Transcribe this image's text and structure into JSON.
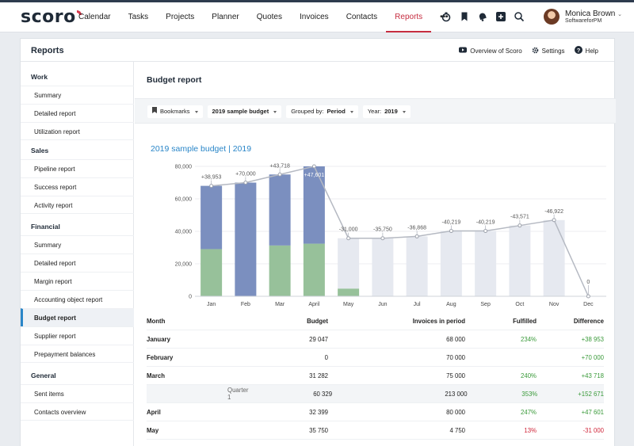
{
  "app": {
    "logo": "scoro",
    "nav": [
      "Calendar",
      "Tasks",
      "Projects",
      "Planner",
      "Quotes",
      "Invoices",
      "Contacts",
      "Reports",
      "•••"
    ],
    "active_nav": "Reports",
    "icons": [
      "timer-icon",
      "bookmark-icon",
      "bell-icon",
      "plus-icon",
      "search-icon"
    ],
    "user": {
      "name": "Monica Brown",
      "company": "SoftwareforPM"
    }
  },
  "panel": {
    "title": "Reports",
    "actions": [
      {
        "icon": "youtube-icon",
        "label": "Overview of Scoro"
      },
      {
        "icon": "gear-icon",
        "label": "Settings"
      },
      {
        "icon": "help-icon",
        "label": "Help"
      }
    ]
  },
  "sidebar": [
    {
      "section": "Work",
      "items": [
        "Summary",
        "Detailed report",
        "Utilization report"
      ]
    },
    {
      "section": "Sales",
      "items": [
        "Pipeline report",
        "Success report",
        "Activity report"
      ]
    },
    {
      "section": "Financial",
      "items": [
        "Summary",
        "Detailed report",
        "Margin report",
        "Accounting object report",
        "Budget report",
        "Supplier report",
        "Prepayment balances"
      ]
    },
    {
      "section": "General",
      "items": [
        "Sent items",
        "Contacts overview"
      ]
    }
  ],
  "active_sidebar": "Budget report",
  "content": {
    "title": "Budget report",
    "filters": {
      "bookmarks": "Bookmarks",
      "budget": "2019 sample budget",
      "grouped_label": "Grouped by:",
      "grouped_value": "Period",
      "year_label": "Year:",
      "year_value": "2019"
    },
    "chart_title": "2019 sample budget | 2019"
  },
  "chart_data": {
    "type": "bar",
    "categories": [
      "Jan",
      "Feb",
      "Mar",
      "April",
      "May",
      "Jun",
      "Jul",
      "Aug",
      "Sep",
      "Oct",
      "Nov",
      "Dec"
    ],
    "ylim": [
      0,
      80000
    ],
    "yticks": [
      "0",
      "20,000",
      "40,000",
      "60,000",
      "80,000"
    ],
    "ytick_values": [
      0,
      20000,
      40000,
      60000,
      80000
    ],
    "series": [
      {
        "values": [
          29047,
          0,
          31282,
          32399,
          4750,
          0,
          0,
          0,
          0,
          0,
          0,
          0
        ],
        "color": "#97c19a"
      },
      {
        "values": [
          38953,
          70000,
          43718,
          47601,
          0,
          0,
          0,
          0,
          0,
          0,
          0,
          0
        ],
        "color": "#7b8fbf"
      },
      {
        "values": [
          0,
          0,
          0,
          0,
          31000,
          35750,
          36868,
          40219,
          40219,
          43571,
          46922,
          0
        ],
        "color": "#e6e9f0"
      }
    ],
    "line": [
      68000,
      70000,
      75000,
      80000,
      35750,
      35750,
      36868,
      40219,
      40219,
      43571,
      46922,
      0
    ],
    "line_color": "#b5b9c2",
    "labels": [
      "+38,953",
      "+70,000",
      "+43,718",
      "+47,601",
      "-31,000",
      "-35,750",
      "-36,868",
      "-40,219",
      "-40,219",
      "-43,571",
      "-46,922",
      "0"
    ]
  },
  "table": {
    "headers": [
      "Month",
      "Budget",
      "Invoices in period",
      "Fulfilled",
      "Difference"
    ],
    "rows": [
      {
        "month": "January",
        "budget": "29 047",
        "invoices": "68 000",
        "fulfilled": "234%",
        "difference": "+38 953",
        "status": "pos"
      },
      {
        "month": "February",
        "budget": "0",
        "invoices": "70 000",
        "fulfilled": "",
        "difference": "+70 000",
        "status": "pos"
      },
      {
        "month": "March",
        "budget": "31 282",
        "invoices": "75 000",
        "fulfilled": "240%",
        "difference": "+43 718",
        "status": "pos"
      },
      {
        "month": "Quarter 1",
        "budget": "60 329",
        "invoices": "213 000",
        "fulfilled": "353%",
        "difference": "+152 671",
        "status": "pos",
        "quarter": true
      },
      {
        "month": "April",
        "budget": "32 399",
        "invoices": "80 000",
        "fulfilled": "247%",
        "difference": "+47 601",
        "status": "pos"
      },
      {
        "month": "May",
        "budget": "35 750",
        "invoices": "4 750",
        "fulfilled": "13%",
        "difference": "-31 000",
        "status": "neg"
      }
    ]
  }
}
